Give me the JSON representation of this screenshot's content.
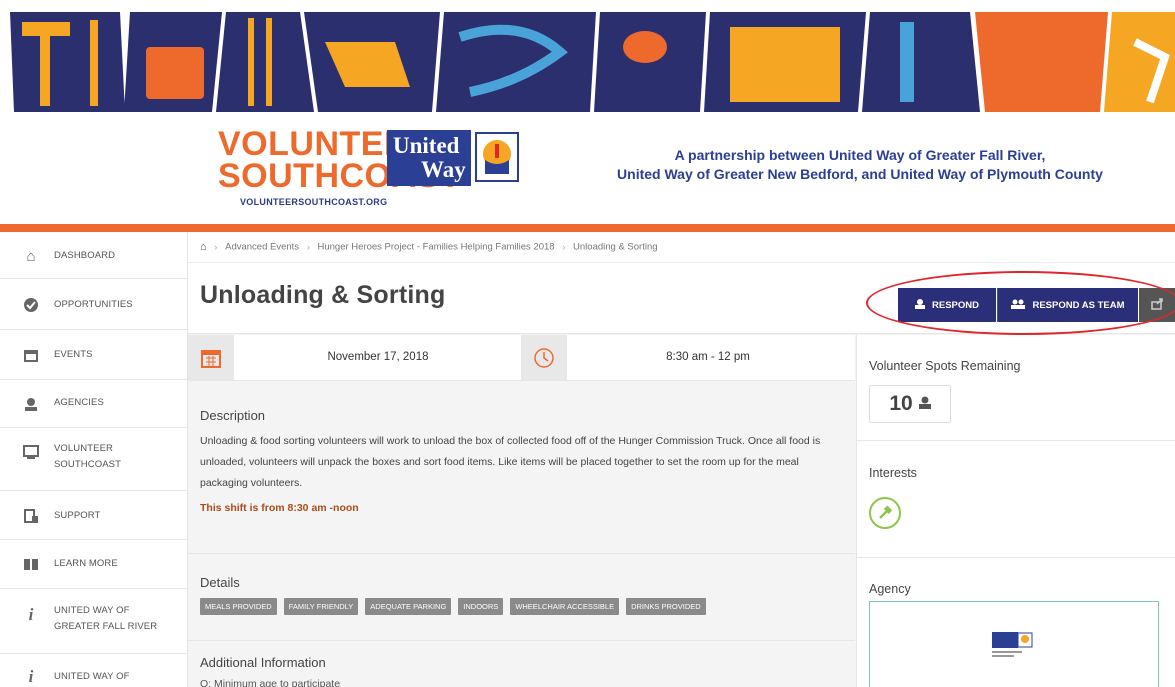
{
  "banner": {
    "logo_line1": "VOLUNTEER",
    "logo_line2": "SOUTHCOAST",
    "logo_url": "VOLUNTEERSOUTHCOAST.ORG",
    "uw_line1": "United",
    "uw_line2": "Way",
    "partnership_line1": "A partnership between United Way of Greater Fall River,",
    "partnership_line2": "United Way of Greater New Bedford, and United Way of Plymouth County",
    "accent_color": "#ee6a2c",
    "brand_color": "#2b3f94"
  },
  "sidebar": {
    "items": [
      {
        "label": "DASHBOARD",
        "icon": "home-icon"
      },
      {
        "label": "OPPORTUNITIES",
        "icon": "check-circle-icon"
      },
      {
        "label": "EVENTS",
        "icon": "calendar-icon"
      },
      {
        "label": "AGENCIES",
        "icon": "agency-icon"
      },
      {
        "label": "VOLUNTEER SOUTHCOAST",
        "icon": "monitor-icon"
      },
      {
        "label": "SUPPORT",
        "icon": "support-icon"
      },
      {
        "label": "LEARN MORE",
        "icon": "book-icon"
      },
      {
        "label": "UNITED WAY OF GREATER FALL RIVER",
        "icon": "info-icon"
      },
      {
        "label": "UNITED WAY OF",
        "icon": "info-icon"
      }
    ]
  },
  "breadcrumb": {
    "items": [
      "Advanced Events",
      "Hunger Heroes Project - Families Helping Families 2018",
      "Unloading & Sorting"
    ]
  },
  "page": {
    "title": "Unloading & Sorting",
    "respond_label": "RESPOND",
    "respond_team_label": "RESPOND AS TEAM"
  },
  "event": {
    "date": "November 17, 2018",
    "time": "8:30 am - 12 pm",
    "description_title": "Description",
    "description": "Unloading & food sorting volunteers will work to unload the box of collected food off of the Hunger Commission Truck. Once all food is unloaded, volunteers will unpack the boxes and sort food items. Like items will be placed together to set the room up for the meal packaging volunteers.",
    "shift_note": "This shift is from 8:30 am -noon",
    "details_title": "Details",
    "tags": [
      "MEALS PROVIDED",
      "FAMILY FRIENDLY",
      "ADEQUATE PARKING",
      "INDOORS",
      "WHEELCHAIR ACCESSIBLE",
      "DRINKS PROVIDED"
    ],
    "additional_title": "Additional Information",
    "additional_q1": "Q: Minimum age to participate"
  },
  "side_panel": {
    "spots_title": "Volunteer Spots Remaining",
    "spots_value": "10",
    "interests_title": "Interests",
    "agency_title": "Agency"
  }
}
